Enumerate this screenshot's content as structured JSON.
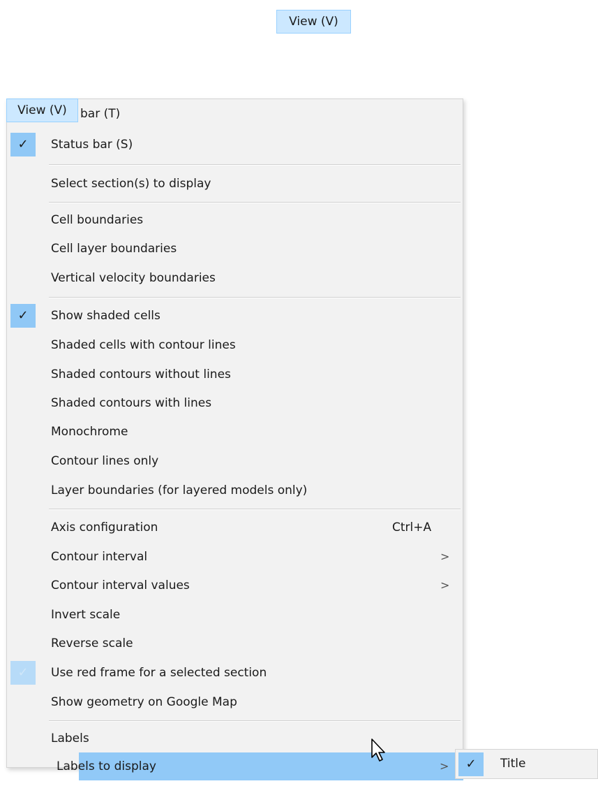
{
  "top_button": {
    "label": "View (V)"
  },
  "menu_tab": {
    "label": "View (V)"
  },
  "menu": {
    "items": [
      {
        "label": "bar (T)",
        "checked": false
      },
      {
        "label": "Status bar (S)",
        "checked": true
      },
      {
        "label": "Select section(s) to display",
        "checked": false
      },
      {
        "label": "Cell boundaries",
        "checked": false
      },
      {
        "label": "Cell layer boundaries",
        "checked": false
      },
      {
        "label": "Vertical velocity boundaries",
        "checked": false
      },
      {
        "label": "Show shaded cells",
        "checked": true
      },
      {
        "label": "Shaded cells with contour lines",
        "checked": false
      },
      {
        "label": "Shaded contours without lines",
        "checked": false
      },
      {
        "label": "Shaded contours with lines",
        "checked": false
      },
      {
        "label": "Monochrome",
        "checked": false
      },
      {
        "label": "Contour lines only",
        "checked": false
      },
      {
        "label": "Layer boundaries (for layered models only)",
        "checked": false
      },
      {
        "label": "Axis configuration",
        "shortcut": "Ctrl+A"
      },
      {
        "label": "Contour interval",
        "submenu": true
      },
      {
        "label": "Contour interval values",
        "submenu": true
      },
      {
        "label": "Invert scale"
      },
      {
        "label": "Reverse scale"
      },
      {
        "label": "Use red frame for a selected section",
        "checked": true,
        "disabled": true
      },
      {
        "label": "Show geometry on Google Map"
      },
      {
        "label": "Labels"
      },
      {
        "label": "Labels to display",
        "submenu": true,
        "highlighted": true
      }
    ],
    "check_glyph": "✓",
    "arrow_glyph": ">"
  },
  "submenu": {
    "items": [
      {
        "label": "Title",
        "checked": true
      }
    ]
  },
  "colors": {
    "menu_background": "#f2f2f2",
    "highlight": "#91c9f7",
    "check_background": "#90c8f6",
    "top_button_background": "#cce8ff"
  },
  "icons": [
    "check-icon",
    "chevron-right-icon",
    "mouse-pointer-icon"
  ]
}
